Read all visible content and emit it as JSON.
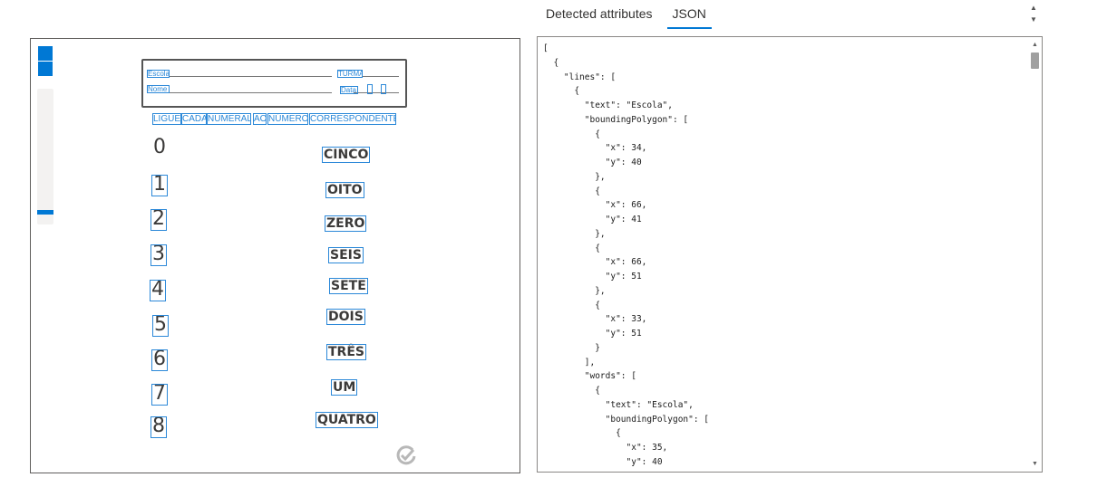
{
  "tabs": [
    {
      "label": "Detected attributes",
      "active": false
    },
    {
      "label": "JSON",
      "active": true
    }
  ],
  "icons": {
    "zoom_in": "zoom-in-icon",
    "zoom_out": "zoom-out-icon",
    "verified": "checkmark-icon",
    "scroll_up": "caret-up-icon",
    "scroll_down": "caret-down-icon"
  },
  "colors": {
    "accent": "#0078d4",
    "bbox": "#2b88d8"
  },
  "document": {
    "form": {
      "escola_label": "Escola",
      "turma_label": "TURMA",
      "nome_label": "Nome",
      "data_label": "Data"
    },
    "instruction_words": [
      "LIGUE",
      "CADA",
      "NUMERAL",
      "AO",
      "NÚMERO",
      "CORRESPONDENTE"
    ],
    "digits": [
      "0",
      "1",
      "2",
      "3",
      "4",
      "5",
      "6",
      "7",
      "8"
    ],
    "words": [
      "CINCO",
      "OITO",
      "ZERO",
      "SEIS",
      "SETE",
      "DOIS",
      "TRÊS",
      "UM",
      "QUATRO"
    ]
  },
  "json_text": [
    "[",
    "  {",
    "    \"lines\": [",
    "      {",
    "        \"text\": \"Escola\",",
    "        \"boundingPolygon\": [",
    "          {",
    "            \"x\": 34,",
    "            \"y\": 40",
    "          },",
    "          {",
    "            \"x\": 66,",
    "            \"y\": 41",
    "          },",
    "          {",
    "            \"x\": 66,",
    "            \"y\": 51",
    "          },",
    "          {",
    "            \"x\": 33,",
    "            \"y\": 51",
    "          }",
    "        ],",
    "        \"words\": [",
    "          {",
    "            \"text\": \"Escola\",",
    "            \"boundingPolygon\": [",
    "              {",
    "                \"x\": 35,",
    "                \"y\": 40"
  ]
}
